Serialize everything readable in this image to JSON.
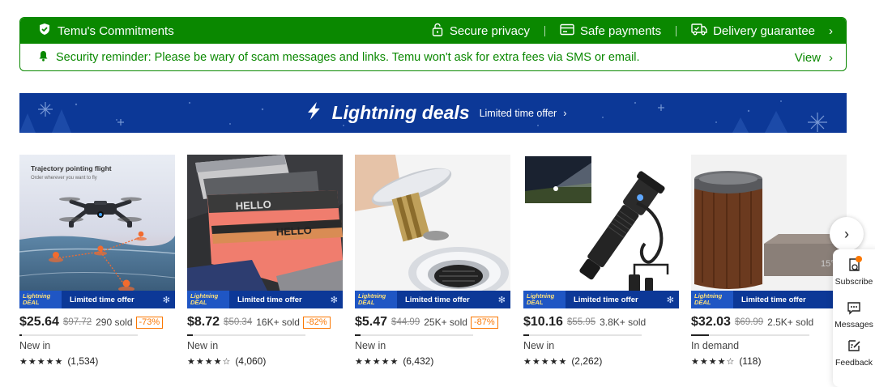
{
  "commitments": {
    "title": "Temu's Commitments",
    "items": [
      "Secure privacy",
      "Safe payments",
      "Delivery guarantee"
    ],
    "reminder": "Security reminder: Please be wary of scam messages and links. Temu won't ask for extra fees via SMS or email.",
    "view_label": "View",
    "color": "#0a8800"
  },
  "banner": {
    "title": "Lightning deals",
    "subtitle": "Limited time offer",
    "color": "#0c3897"
  },
  "deal_badge": {
    "label_top": "Lightning",
    "label_bottom": "DEAL",
    "text": "Limited time offer"
  },
  "products": [
    {
      "image_caption": "Trajectory pointing flight",
      "image_sub": "Order wherever you want to fly",
      "price": "$25.64",
      "orig": "$97.72",
      "sold": "290 sold",
      "discount": "-73%",
      "progress": 0.02,
      "tag": "New in",
      "stars": "★★★★★",
      "reviews": "(1,534)"
    },
    {
      "price": "$8.72",
      "orig": "$50.34",
      "sold": "16K+ sold",
      "discount": "-82%",
      "progress": 0.05,
      "tag": "New in",
      "stars": "★★★★☆",
      "reviews": "(4,060)"
    },
    {
      "price": "$5.47",
      "orig": "$44.99",
      "sold": "25K+ sold",
      "discount": "-87%",
      "progress": 0.05,
      "tag": "New in",
      "stars": "★★★★★",
      "reviews": "(6,432)"
    },
    {
      "price": "$10.16",
      "orig": "$55.95",
      "sold": "3.8K+ sold",
      "discount": "",
      "progress": 0.05,
      "tag": "New in",
      "stars": "★★★★★",
      "reviews": "(2,262)"
    },
    {
      "price": "$32.03",
      "orig": "$69.99",
      "sold": "2.5K+ sold",
      "discount": "",
      "progress": 0.15,
      "tag": "In demand",
      "stars": "★★★★☆",
      "reviews": "(118)"
    }
  ],
  "side_panel": {
    "items": [
      "Subscribe",
      "Messages",
      "Feedback"
    ]
  },
  "accent_orange": "#fb7701"
}
